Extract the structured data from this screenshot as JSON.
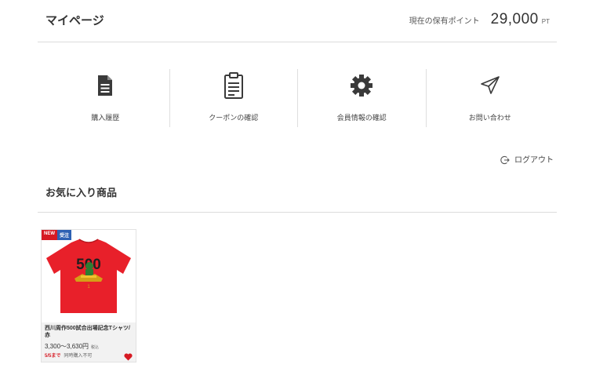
{
  "header": {
    "page_title": "マイページ",
    "points_label": "現在の保有ポイント",
    "points_value": "29,000",
    "points_unit": "PT"
  },
  "menu": [
    {
      "label": "購入履歴",
      "icon": "document-icon"
    },
    {
      "label": "クーポンの確認",
      "icon": "clipboard-icon"
    },
    {
      "label": "会員情報の確認",
      "icon": "gear-icon"
    },
    {
      "label": "お問い合わせ",
      "icon": "paper-plane-icon"
    }
  ],
  "logout": {
    "label": "ログアウト",
    "icon": "logout-icon"
  },
  "favorites": {
    "title": "お気に入り商品",
    "items": [
      {
        "badge_new": "NEW",
        "badge_order": "受注",
        "name": "西川周作500試合出場記念Tシャツ/赤",
        "price": "3,300～3,630円",
        "tax": "税込",
        "deadline": "5/5まで",
        "note": "同時購入不可",
        "image_text": "500",
        "image_number": "1",
        "favorited": true
      }
    ]
  },
  "colors": {
    "accent_red": "#d61a23",
    "badge_blue": "#2d61b3",
    "icon_dark": "#3a3a3a",
    "shirt_red": "#e8202a"
  }
}
